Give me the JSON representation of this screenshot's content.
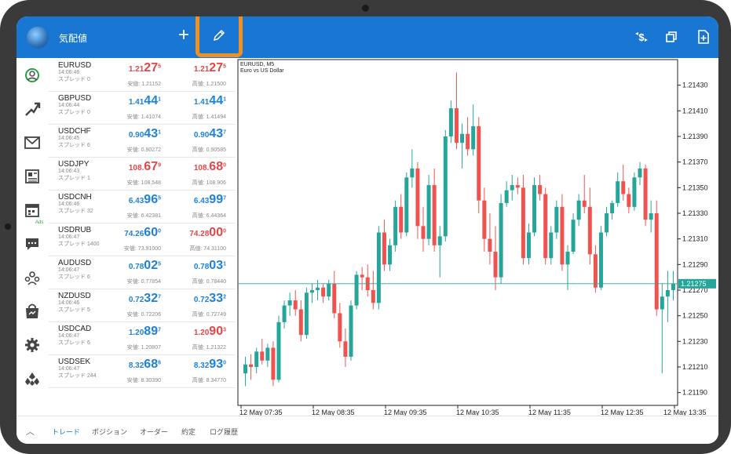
{
  "app": {
    "title": "気配値"
  },
  "colors": {
    "topbar": "#1976d2",
    "bid_up": "#1e82d8",
    "bid_down": "#e04848",
    "bull": "#26a69a",
    "bear": "#ef5350",
    "highlight": "#f0901e"
  },
  "toolbar": {
    "icons": [
      "add-symbol-icon",
      "edit-pencil-icon",
      "currency-exchange-icon",
      "copy-windows-icon",
      "add-document-icon"
    ]
  },
  "nav": {
    "ads_label": "Ads",
    "icons": [
      "quotes-icon",
      "chart-icon",
      "mail-icon",
      "news-icon",
      "calendar-icon",
      "chat-icon",
      "community-icon",
      "store-icon",
      "settings-icon",
      "traders-icon"
    ]
  },
  "quotes": [
    {
      "symbol": "EURUSD",
      "time": "14:06:46",
      "spread": "スプレッド 0",
      "bid": {
        "pre": "1.21",
        "big": "27",
        "sup": "5",
        "color": "red"
      },
      "ask": {
        "pre": "1.21",
        "big": "27",
        "sup": "5",
        "color": "red"
      },
      "low": "安値: 1.21152",
      "high": "高値: 1.21500"
    },
    {
      "symbol": "GBPUSD",
      "time": "14:06:44",
      "spread": "スプレッド 0",
      "bid": {
        "pre": "1.41",
        "big": "44",
        "sup": "1",
        "color": "blue"
      },
      "ask": {
        "pre": "1.41",
        "big": "44",
        "sup": "1",
        "color": "blue"
      },
      "low": "安値: 1.41074",
      "high": "高値: 1.41494"
    },
    {
      "symbol": "USDCHF",
      "time": "14:06:45",
      "spread": "スプレッド 6",
      "bid": {
        "pre": "0.90",
        "big": "43",
        "sup": "1",
        "color": "blue"
      },
      "ask": {
        "pre": "0.90",
        "big": "43",
        "sup": "7",
        "color": "blue"
      },
      "low": "安値: 0.90272",
      "high": "高値: 0.90585"
    },
    {
      "symbol": "USDJPY",
      "time": "14:06:43",
      "spread": "スプレッド 1",
      "bid": {
        "pre": "108.",
        "big": "67",
        "sup": "9",
        "color": "red"
      },
      "ask": {
        "pre": "108.",
        "big": "68",
        "sup": "0",
        "color": "red"
      },
      "low": "安値: 108.548",
      "high": "高値: 108.906"
    },
    {
      "symbol": "USDCNH",
      "time": "14:06:46",
      "spread": "スプレッド 32",
      "bid": {
        "pre": "6.43",
        "big": "96",
        "sup": "5",
        "color": "blue"
      },
      "ask": {
        "pre": "6.43",
        "big": "99",
        "sup": "7",
        "color": "blue"
      },
      "low": "安値: 6.42381",
      "high": "高値: 6.44364"
    },
    {
      "symbol": "USDRUB",
      "time": "14:06:47",
      "spread": "スプレッド 1400",
      "bid": {
        "pre": "74.26",
        "big": "60",
        "sup": "0",
        "color": "blue"
      },
      "ask": {
        "pre": "74.28",
        "big": "00",
        "sup": "0",
        "color": "red"
      },
      "low": "安値: 73.91000",
      "high": "高値: 74.31100"
    },
    {
      "symbol": "AUDUSD",
      "time": "14:06:47",
      "spread": "スプレッド 6",
      "bid": {
        "pre": "0.78",
        "big": "02",
        "sup": "5",
        "color": "blue"
      },
      "ask": {
        "pre": "0.78",
        "big": "03",
        "sup": "1",
        "color": "blue"
      },
      "low": "安値: 0.77854",
      "high": "高値: 0.78440"
    },
    {
      "symbol": "NZDUSD",
      "time": "14:06:46",
      "spread": "スプレッド 5",
      "bid": {
        "pre": "0.72",
        "big": "32",
        "sup": "7",
        "color": "blue"
      },
      "ask": {
        "pre": "0.72",
        "big": "33",
        "sup": "2",
        "color": "blue"
      },
      "low": "安値: 0.72206",
      "high": "高値: 0.72749"
    },
    {
      "symbol": "USDCAD",
      "time": "14:06:47",
      "spread": "スプレッド 6",
      "bid": {
        "pre": "1.20",
        "big": "89",
        "sup": "7",
        "color": "blue"
      },
      "ask": {
        "pre": "1.20",
        "big": "90",
        "sup": "3",
        "color": "red"
      },
      "low": "安値: 1.20807",
      "high": "高値: 1.21322"
    },
    {
      "symbol": "USDSEK",
      "time": "14:06:47",
      "spread": "スプレッド 244",
      "bid": {
        "pre": "8.32",
        "big": "68",
        "sup": "6",
        "color": "blue"
      },
      "ask": {
        "pre": "8.32",
        "big": "93",
        "sup": "0",
        "color": "blue"
      },
      "low": "安値: 8.30390",
      "high": "高値: 8.34770"
    }
  ],
  "chart": {
    "symbol_line": "EURUSD, M5",
    "desc_line": "Euro vs US Dollar",
    "current_price": "1.21275"
  },
  "chart_data": {
    "type": "candlestick",
    "title": "EURUSD, M5",
    "subtitle": "Euro vs US Dollar",
    "y_ticks": [
      "1.21430",
      "1.21410",
      "1.21390",
      "1.21370",
      "1.21350",
      "1.21330",
      "1.21310",
      "1.21290",
      "1.21270",
      "1.21250",
      "1.21230",
      "1.21210",
      "1.21190"
    ],
    "x_ticks": [
      "12 May 07:35",
      "12 May 08:35",
      "12 May 09:35",
      "12 May 10:35",
      "12 May 11:35",
      "12 May 12:35",
      "12 May 13:35"
    ],
    "ylim": [
      1.2118,
      1.2145
    ],
    "current": 1.21275,
    "candles": [
      [
        1.21205,
        1.21218,
        1.21195,
        1.21212
      ],
      [
        1.21212,
        1.2122,
        1.212,
        1.2121
      ],
      [
        1.2121,
        1.21225,
        1.21205,
        1.21222
      ],
      [
        1.21222,
        1.21232,
        1.21212,
        1.21215
      ],
      [
        1.21215,
        1.21228,
        1.2121,
        1.21225
      ],
      [
        1.21225,
        1.2123,
        1.21195,
        1.212
      ],
      [
        1.212,
        1.2125,
        1.21198,
        1.21245
      ],
      [
        1.21245,
        1.21262,
        1.2124,
        1.21258
      ],
      [
        1.21258,
        1.21268,
        1.2125,
        1.21262
      ],
      [
        1.21262,
        1.2127,
        1.2125,
        1.21255
      ],
      [
        1.21255,
        1.21262,
        1.2123,
        1.21235
      ],
      [
        1.21235,
        1.21272,
        1.21232,
        1.21268
      ],
      [
        1.21268,
        1.21275,
        1.2126,
        1.2127
      ],
      [
        1.2127,
        1.21278,
        1.21262,
        1.21272
      ],
      [
        1.21272,
        1.21275,
        1.2126,
        1.21265
      ],
      [
        1.21265,
        1.21278,
        1.21262,
        1.21275
      ],
      [
        1.21275,
        1.21285,
        1.21248,
        1.21252
      ],
      [
        1.21252,
        1.2126,
        1.21225,
        1.2123
      ],
      [
        1.2123,
        1.2124,
        1.2121,
        1.21218
      ],
      [
        1.21218,
        1.21262,
        1.21215,
        1.21258
      ],
      [
        1.21258,
        1.21285,
        1.21255,
        1.21282
      ],
      [
        1.21282,
        1.21288,
        1.2127,
        1.2128
      ],
      [
        1.2128,
        1.2129,
        1.21265,
        1.2127
      ],
      [
        1.2127,
        1.21285,
        1.21255,
        1.2126
      ],
      [
        1.2126,
        1.2132,
        1.21255,
        1.21315
      ],
      [
        1.21315,
        1.21325,
        1.21285,
        1.2129
      ],
      [
        1.2129,
        1.2131,
        1.21285,
        1.21305
      ],
      [
        1.21305,
        1.2134,
        1.213,
        1.21335
      ],
      [
        1.21335,
        1.21345,
        1.2131,
        1.21315
      ],
      [
        1.21315,
        1.21362,
        1.21312,
        1.21358
      ],
      [
        1.21358,
        1.2138,
        1.2135,
        1.21365
      ],
      [
        1.21365,
        1.2137,
        1.2131,
        1.2132
      ],
      [
        1.2132,
        1.21335,
        1.213,
        1.2131
      ],
      [
        1.2131,
        1.2136,
        1.21305,
        1.21352
      ],
      [
        1.21352,
        1.21365,
        1.213,
        1.21305
      ],
      [
        1.21305,
        1.2132,
        1.2128,
        1.21312
      ],
      [
        1.21312,
        1.21395,
        1.21308,
        1.2139
      ],
      [
        1.2139,
        1.21418,
        1.21385,
        1.21412
      ],
      [
        1.21412,
        1.2144,
        1.2138,
        1.21385
      ],
      [
        1.21385,
        1.214,
        1.21365,
        1.21392
      ],
      [
        1.21392,
        1.21405,
        1.21375,
        1.2138
      ],
      [
        1.2138,
        1.21415,
        1.21375,
        1.21398
      ],
      [
        1.21398,
        1.21405,
        1.2133,
        1.2134
      ],
      [
        1.2134,
        1.2135,
        1.213,
        1.2131
      ],
      [
        1.2131,
        1.2133,
        1.2129,
        1.213
      ],
      [
        1.213,
        1.2132,
        1.2127,
        1.2128
      ],
      [
        1.2128,
        1.21345,
        1.21275,
        1.21338
      ],
      [
        1.21338,
        1.21355,
        1.21335,
        1.21348
      ],
      [
        1.21348,
        1.2136,
        1.2134,
        1.21352
      ],
      [
        1.21352,
        1.21358,
        1.21345,
        1.2135
      ],
      [
        1.2135,
        1.2136,
        1.2129,
        1.21295
      ],
      [
        1.21295,
        1.21322,
        1.2129,
        1.21315
      ],
      [
        1.21315,
        1.21358,
        1.21312,
        1.21352
      ],
      [
        1.21352,
        1.2136,
        1.2134,
        1.21345
      ],
      [
        1.21345,
        1.2135,
        1.2129,
        1.21295
      ],
      [
        1.21295,
        1.2132,
        1.2129,
        1.21315
      ],
      [
        1.21315,
        1.2134,
        1.2131,
        1.21335
      ],
      [
        1.21335,
        1.21345,
        1.21285,
        1.2129
      ],
      [
        1.2129,
        1.21305,
        1.2127,
        1.213
      ],
      [
        1.213,
        1.2133,
        1.21298,
        1.21325
      ],
      [
        1.21325,
        1.21345,
        1.2132,
        1.2134
      ],
      [
        1.2134,
        1.2136,
        1.2133,
        1.21335
      ],
      [
        1.21335,
        1.2135,
        1.2129,
        1.21298
      ],
      [
        1.21298,
        1.21305,
        1.21268,
        1.21272
      ],
      [
        1.21272,
        1.2132,
        1.2127,
        1.21315
      ],
      [
        1.21315,
        1.21335,
        1.21312,
        1.2133
      ],
      [
        1.2133,
        1.2134,
        1.21325,
        1.21338
      ],
      [
        1.21338,
        1.21362,
        1.21335,
        1.21355
      ],
      [
        1.21355,
        1.21368,
        1.2134,
        1.21345
      ],
      [
        1.21345,
        1.2135,
        1.2133,
        1.21335
      ],
      [
        1.21335,
        1.21362,
        1.21332,
        1.21358
      ],
      [
        1.21358,
        1.2137,
        1.21352,
        1.21365
      ],
      [
        1.21365,
        1.21368,
        1.2132,
        1.21325
      ],
      [
        1.21325,
        1.2134,
        1.21315,
        1.2133
      ],
      [
        1.2133,
        1.2134,
        1.2125,
        1.21255
      ],
      [
        1.21255,
        1.21275,
        1.21205,
        1.21265
      ],
      [
        1.21265,
        1.21285,
        1.21245,
        1.2127
      ],
      [
        1.2127,
        1.21285,
        1.21262,
        1.21275
      ]
    ]
  },
  "bottom": {
    "chevron": "︿",
    "tabs": [
      "トレード",
      "ポジション",
      "オーダー",
      "約定",
      "ログ履歴"
    ],
    "active": 0
  }
}
